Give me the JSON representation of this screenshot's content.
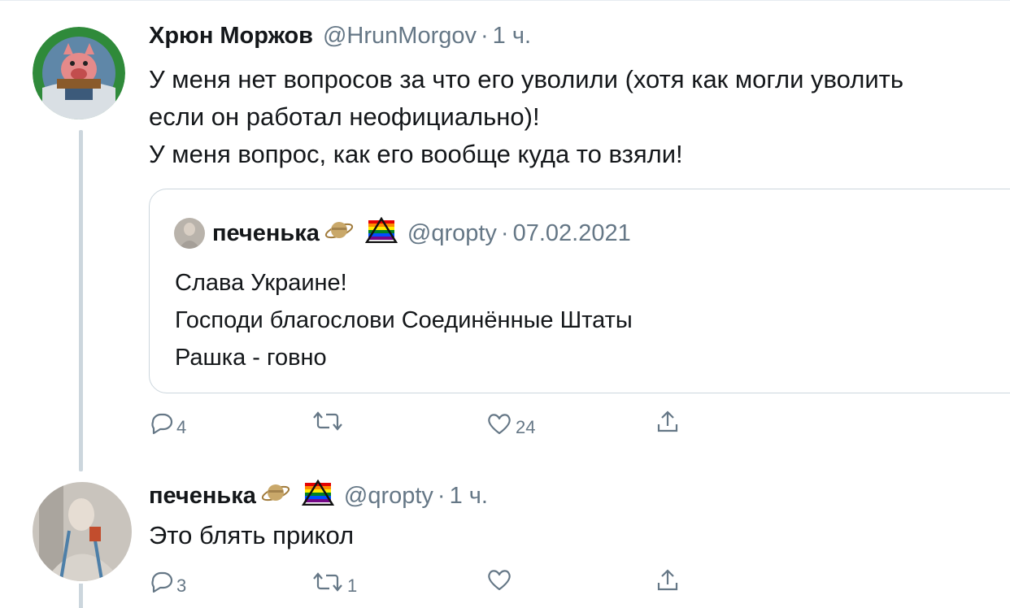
{
  "tweet1": {
    "name": "Хрюн Моржов",
    "handle": "@HrunMorgov",
    "separator": "·",
    "time": "1 ч.",
    "lines": [
      "У меня нет вопросов за что его уволили (хотя как могли уволить",
      "если он работал неофициально)!",
      "У меня вопрос, как его вообще куда то взяли!"
    ],
    "avatar_text": "Хрюн Моржов",
    "quote": {
      "name": "печенька",
      "handle": "@qropty",
      "separator": "·",
      "date": "07.02.2021",
      "lines": [
        "Слава Украине!",
        "Господи благослови Соединённые Штаты",
        "Рашка - говно"
      ]
    },
    "actions": {
      "reply_count": "4",
      "retweet_count": "",
      "like_count": "24"
    }
  },
  "tweet2": {
    "name": "печенька",
    "handle": "@qropty",
    "separator": "·",
    "time": "1 ч.",
    "lines": [
      "Это блять прикол"
    ],
    "actions": {
      "reply_count": "3",
      "retweet_count": "1",
      "like_count": ""
    }
  },
  "icons": {
    "reply": "speech-bubble-icon",
    "retweet": "retweet-arrows-icon",
    "like": "heart-icon",
    "share": "share-upload-icon",
    "saturn": "saturn-emoji",
    "pride": "pride-triangle-emoji"
  },
  "colors": {
    "text": "#14171a",
    "secondary": "#657786",
    "border": "#ccd6dd"
  }
}
